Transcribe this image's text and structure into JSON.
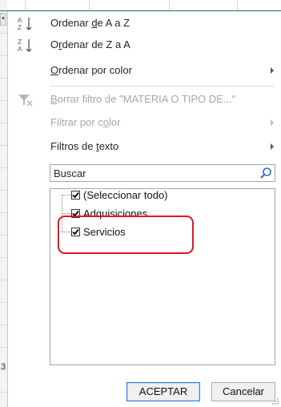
{
  "sheet": {
    "row_number": "3"
  },
  "menu": {
    "sort_az": {
      "label_pre": "Ordenar ",
      "label_key": "d",
      "label_post": "e A a Z"
    },
    "sort_za": {
      "label_pre": "O",
      "label_key": "r",
      "label_post": "denar de Z a A"
    },
    "sort_color": {
      "label_key": "O",
      "label_post": "rdenar por color"
    },
    "clear_filter": {
      "label_key": "B",
      "label_post": "orrar filtro de \"MATERIA O TIPO DE...\""
    },
    "filter_color": {
      "label_pre": "Filtrar por c",
      "label_key": "o",
      "label_post": "lor"
    },
    "text_filters": {
      "label_pre": "Filtros de ",
      "label_key": "t",
      "label_post": "exto"
    }
  },
  "search": {
    "placeholder": "Buscar"
  },
  "list": {
    "items": [
      {
        "label": "(Seleccionar todo)",
        "checked": true
      },
      {
        "label": "Adquisiciones",
        "checked": true
      },
      {
        "label": "Servicios",
        "checked": true
      }
    ]
  },
  "buttons": {
    "ok": "ACEPTAR",
    "cancel": "Cancelar"
  },
  "colors": {
    "highlight": "#e0141e",
    "ok_border": "#2b78d4",
    "sheet_accent": "#217346"
  }
}
